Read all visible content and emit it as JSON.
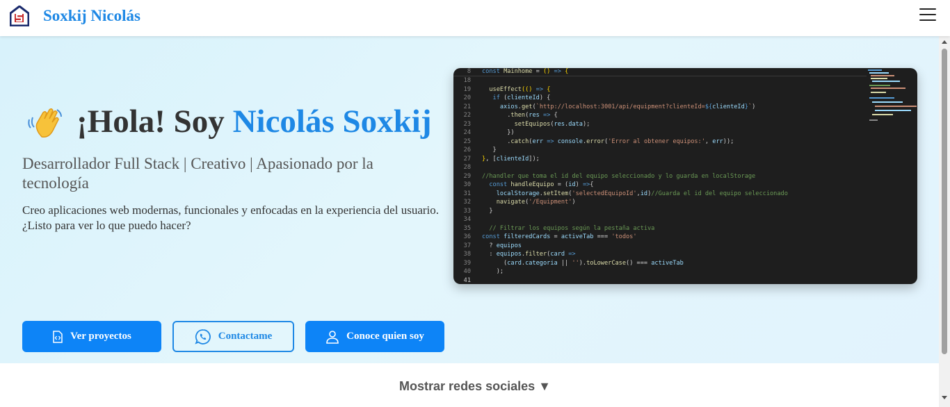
{
  "navbar": {
    "brand": "Soxkij Nicolás",
    "logo_icon": "house-s-logo-icon",
    "menu_icon": "hamburger-menu-icon"
  },
  "hero": {
    "emoji_icon": "waving-hand-icon",
    "title_prefix": "¡Hola! Soy ",
    "title_name": "Nicolás Soxkij",
    "subtitle": "Desarrollador Full Stack | Creativo | Apasionado por la tecnología",
    "description": "Creo aplicaciones web modernas, funcionales y enfocadas en la experiencia del usuario. ¿Listo para ver lo que puedo hacer?",
    "buttons": [
      {
        "label": "Ver proyectos",
        "icon": "code-file-icon"
      },
      {
        "label": "Contactame",
        "icon": "whatsapp-icon"
      },
      {
        "label": "Conoce quien soy",
        "icon": "user-icon"
      }
    ]
  },
  "social_toggle": {
    "label": "Mostrar redes sociales ▼"
  },
  "colors": {
    "accent": "#1e88e5",
    "button_primary": "#0d84f7",
    "hero_background": "#dff4fc",
    "code_background": "#1e1e1e"
  }
}
